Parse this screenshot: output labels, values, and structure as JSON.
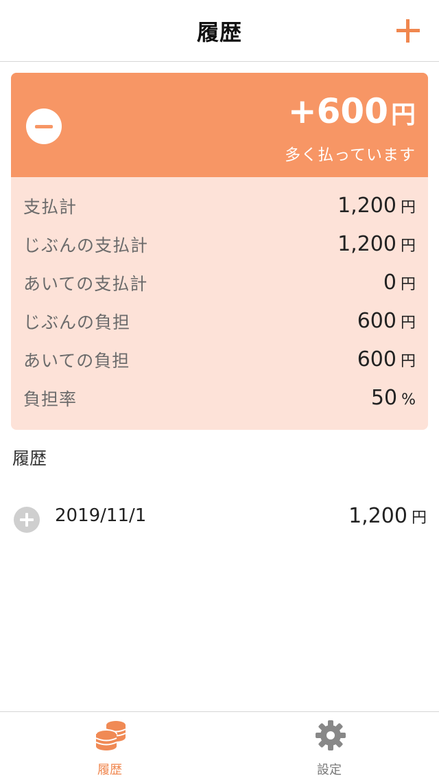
{
  "header": {
    "title": "履歴"
  },
  "balance": {
    "amount": "+600",
    "unit": "円",
    "status": "多く払っています"
  },
  "summary": [
    {
      "label": "支払計",
      "value": "1,200",
      "unit": "円"
    },
    {
      "label": "じぶんの支払計",
      "value": "1,200",
      "unit": "円"
    },
    {
      "label": "あいての支払計",
      "value": "0",
      "unit": "円"
    },
    {
      "label": "じぶんの負担",
      "value": "600",
      "unit": "円"
    },
    {
      "label": "あいての負担",
      "value": "600",
      "unit": "円"
    },
    {
      "label": "負担率",
      "value": "50",
      "unit": "%"
    }
  ],
  "history": {
    "title": "履歴",
    "items": [
      {
        "date": "2019/11/1",
        "amount": "1,200",
        "unit": "円"
      }
    ]
  },
  "tabs": [
    {
      "label": "履歴",
      "icon": "coins-icon",
      "active": true
    },
    {
      "label": "設定",
      "icon": "gear-icon",
      "active": false
    }
  ],
  "colors": {
    "accent": "#f79665",
    "card_background": "#fde2d8",
    "active_tab": "#f0874f",
    "inactive_tab": "#777777"
  }
}
